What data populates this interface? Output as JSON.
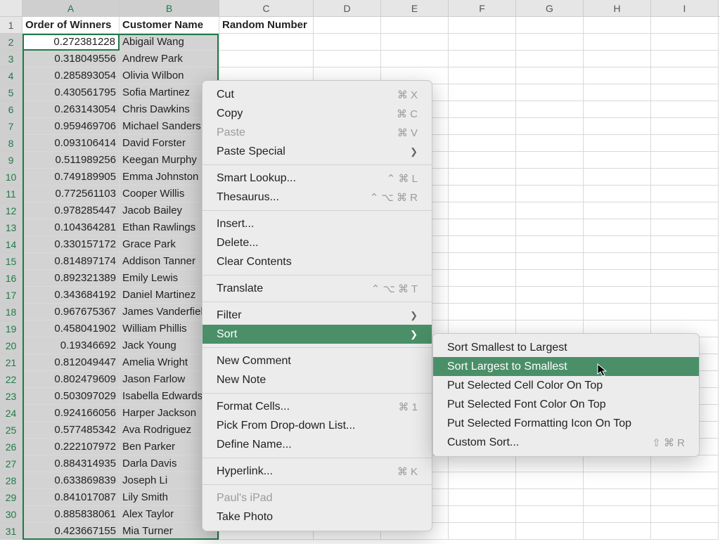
{
  "columns": [
    "A",
    "B",
    "C",
    "D",
    "E",
    "F",
    "G",
    "H",
    "I"
  ],
  "headers": {
    "A": "Order of Winners",
    "B": "Customer Name",
    "C": "Random Number"
  },
  "rows": [
    {
      "n": "0.272381228",
      "name": "Abigail Wang"
    },
    {
      "n": "0.318049556",
      "name": "Andrew Park"
    },
    {
      "n": "0.285893054",
      "name": "Olivia Wilbon"
    },
    {
      "n": "0.430561795",
      "name": "Sofia Martinez"
    },
    {
      "n": "0.263143054",
      "name": "Chris Dawkins"
    },
    {
      "n": "0.959469706",
      "name": "Michael Sanders"
    },
    {
      "n": "0.093106414",
      "name": "David Forster"
    },
    {
      "n": "0.511989256",
      "name": "Keegan Murphy"
    },
    {
      "n": "0.749189905",
      "name": "Emma Johnston"
    },
    {
      "n": "0.772561103",
      "name": "Cooper Willis"
    },
    {
      "n": "0.978285447",
      "name": "Jacob Bailey"
    },
    {
      "n": "0.104364281",
      "name": "Ethan Rawlings"
    },
    {
      "n": "0.330157172",
      "name": "Grace Park"
    },
    {
      "n": "0.814897174",
      "name": "Addison Tanner"
    },
    {
      "n": "0.892321389",
      "name": "Emily Lewis"
    },
    {
      "n": "0.343684192",
      "name": "Daniel Martinez"
    },
    {
      "n": "0.967675367",
      "name": "James Vanderfield"
    },
    {
      "n": "0.458041902",
      "name": "William Phillis"
    },
    {
      "n": "0.19346692",
      "name": "Jack Young"
    },
    {
      "n": "0.812049447",
      "name": "Amelia Wright"
    },
    {
      "n": "0.802479609",
      "name": "Jason Farlow"
    },
    {
      "n": "0.503097029",
      "name": "Isabella Edwards"
    },
    {
      "n": "0.924166056",
      "name": "Harper Jackson"
    },
    {
      "n": "0.577485342",
      "name": "Ava Rodriguez"
    },
    {
      "n": "0.222107972",
      "name": "Ben Parker"
    },
    {
      "n": "0.884314935",
      "name": "Darla Davis"
    },
    {
      "n": "0.633869839",
      "name": "Joseph Li"
    },
    {
      "n": "0.841017087",
      "name": "Lily Smith"
    },
    {
      "n": "0.885838061",
      "name": "Alex Taylor"
    },
    {
      "n": "0.423667155",
      "name": "Mia Turner"
    }
  ],
  "ctx_main": {
    "cut": "Cut",
    "cut_k": "⌘ X",
    "copy": "Copy",
    "copy_k": "⌘ C",
    "paste": "Paste",
    "paste_k": "⌘ V",
    "paste_special": "Paste Special",
    "smart_lookup": "Smart Lookup...",
    "smart_lookup_k": "⌃ ⌘ L",
    "thesaurus": "Thesaurus...",
    "thesaurus_k": "⌃ ⌥ ⌘ R",
    "insert": "Insert...",
    "delete": "Delete...",
    "clear": "Clear Contents",
    "translate": "Translate",
    "translate_k": "⌃ ⌥ ⌘ T",
    "filter": "Filter",
    "sort": "Sort",
    "new_comment": "New Comment",
    "new_note": "New Note",
    "format_cells": "Format Cells...",
    "format_cells_k": "⌘ 1",
    "pick_list": "Pick From Drop-down List...",
    "define_name": "Define Name...",
    "hyperlink": "Hyperlink...",
    "hyperlink_k": "⌘ K",
    "pauls_ipad": "Paul's iPad",
    "take_photo": "Take Photo"
  },
  "ctx_sort": {
    "asc": "Sort Smallest to Largest",
    "desc": "Sort Largest to Smallest",
    "cell_color": "Put Selected Cell Color On Top",
    "font_color": "Put Selected Font Color On Top",
    "fmt_icon": "Put Selected Formatting Icon On Top",
    "custom": "Custom Sort...",
    "custom_k": "⇧ ⌘ R"
  }
}
